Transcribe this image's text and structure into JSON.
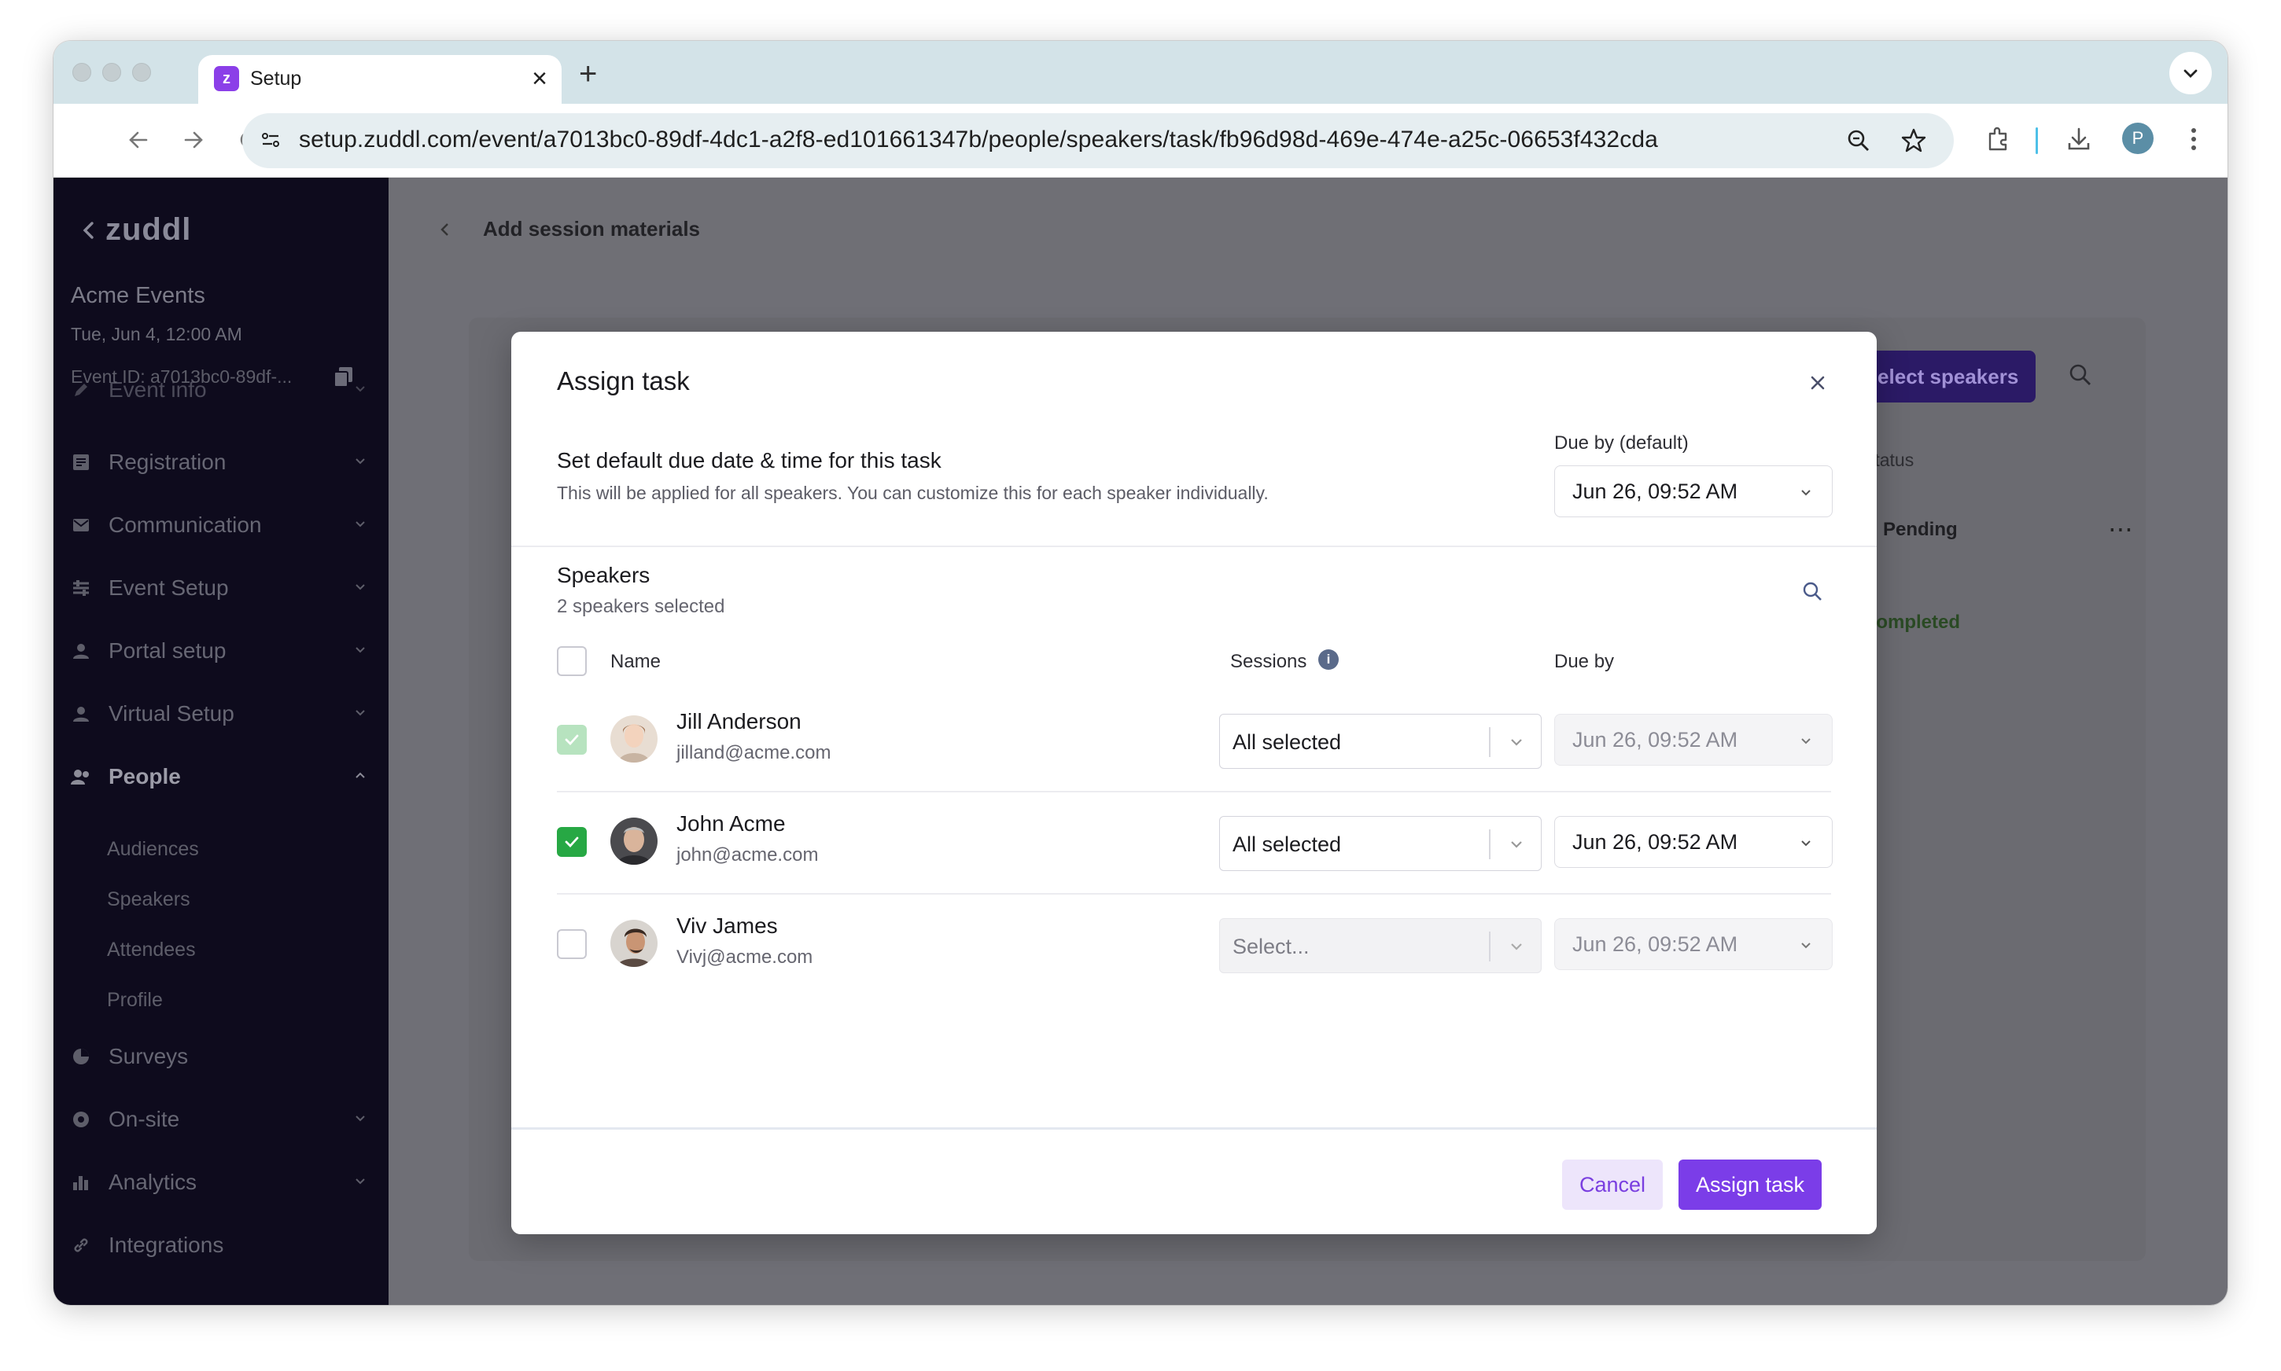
{
  "browser": {
    "tab_title": "Setup",
    "tab_favicon_letter": "z",
    "url": "setup.zuddl.com/event/a7013bc0-89df-4dc1-a2f8-ed101661347b/people/speakers/task/fb96d98d-469e-474e-a25c-06653f432cda",
    "profile_initial": "P"
  },
  "sidebar": {
    "brand": "zuddl",
    "org_name": "Acme Events",
    "event_date": "Tue, Jun 4, 12:00 AM",
    "event_id": "Event ID: a7013bc0-89df-...",
    "items": [
      {
        "label": "Event info",
        "icon": "edit-icon"
      },
      {
        "label": "Registration",
        "icon": "form-icon"
      },
      {
        "label": "Communication",
        "icon": "mail-icon"
      },
      {
        "label": "Event Setup",
        "icon": "sliders-icon"
      },
      {
        "label": "Portal setup",
        "icon": "user-icon"
      },
      {
        "label": "Virtual Setup",
        "icon": "user-icon"
      },
      {
        "label": "People",
        "icon": "people-icon"
      },
      {
        "label": "Surveys",
        "icon": "pie-icon"
      },
      {
        "label": "On-site",
        "icon": "location-icon"
      },
      {
        "label": "Analytics",
        "icon": "bar-chart-icon"
      },
      {
        "label": "Integrations",
        "icon": "link-icon"
      }
    ],
    "people_sub": [
      "Audiences",
      "Speakers",
      "Attendees",
      "Profile"
    ]
  },
  "page": {
    "title": "Add session materials",
    "select_speakers_label": "Select speakers",
    "status_header": "Status",
    "status_pending": "Pending",
    "status_completed": "Completed"
  },
  "modal": {
    "title": "Assign task",
    "default_section_title": "Set default due date & time for this task",
    "default_section_desc": "This will be applied for all speakers. You can customize this for each speaker individually.",
    "due_default_label": "Due by (default)",
    "due_default_value": "Jun 26, 09:52 AM",
    "speakers_title": "Speakers",
    "speakers_selected": "2 speakers selected",
    "col_name": "Name",
    "col_sessions": "Sessions",
    "col_due": "Due by",
    "speakers": [
      {
        "name": "Jill Anderson",
        "email": "jilland@acme.com",
        "checked": true,
        "sessions": "All selected",
        "due": "Jun 26, 09:52 AM"
      },
      {
        "name": "John Acme",
        "email": "john@acme.com",
        "checked": true,
        "sessions": "All selected",
        "due": "Jun 26, 09:52 AM"
      },
      {
        "name": "Viv James",
        "email": "Vivj@acme.com",
        "checked": false,
        "sessions": "Select...",
        "due": "Jun 26, 09:52 AM"
      }
    ],
    "cancel_label": "Cancel",
    "assign_label": "Assign task"
  },
  "colors": {
    "accent": "#7b3de8",
    "check_green": "#27a844",
    "sidebar_bg": "#0e0b1d"
  }
}
